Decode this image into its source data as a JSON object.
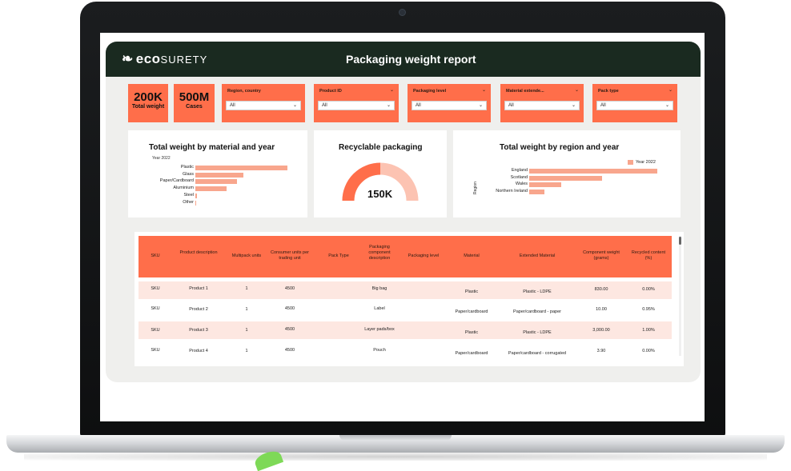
{
  "header": {
    "logo_text_bold": "eco",
    "logo_text_rest": "SURETY",
    "title": "Packaging weight report"
  },
  "kpis": [
    {
      "value": "200K",
      "label": "Total weight"
    },
    {
      "value": "500M",
      "label": "Cases"
    }
  ],
  "filters": [
    {
      "label": "Region, country",
      "value": "All"
    },
    {
      "label": "Product ID",
      "value": "All"
    },
    {
      "label": "Packaging level",
      "value": "All"
    },
    {
      "label": "Material extende...",
      "value": "All"
    },
    {
      "label": "Pack type",
      "value": "All"
    }
  ],
  "material_chart": {
    "title": "Total weight by material and year",
    "subtitle": "Year 2022",
    "chart_data": {
      "type": "bar",
      "categories": [
        "Plastic",
        "Glass",
        "Paper/Cardboard",
        "Aluminium",
        "Steel",
        "Other"
      ],
      "values": [
        100,
        52,
        45,
        34,
        2,
        1
      ],
      "xlim": [
        0,
        100
      ]
    }
  },
  "recyclable": {
    "title": "Recyclable packaging",
    "value": "150K",
    "fraction": 0.5
  },
  "region_chart": {
    "title": "Total weight by region and year",
    "legend": "Year 2022",
    "axis_title": "Region",
    "chart_data": {
      "type": "bar",
      "categories": [
        "England",
        "Scotland",
        "Wales",
        "Northern Ireland"
      ],
      "values": [
        100,
        57,
        25,
        12
      ],
      "xlim": [
        0,
        100
      ]
    }
  },
  "table": {
    "columns": [
      "SKU",
      "Product description",
      "Multipack units",
      "Consumer units per trading unit",
      "Pack Type",
      "Packaging component description",
      "Packaging level",
      "Material",
      "Extended Material",
      "Component weight (grams)",
      "Recycled content (%)"
    ],
    "rows": [
      [
        "SKU",
        "Product 1",
        "1",
        "4500",
        "",
        "Big bag",
        "",
        "Plastic",
        "Plastic - LDPE",
        "830.00",
        "0.00%"
      ],
      [
        "SKU",
        "Product 2",
        "1",
        "4500",
        "",
        "Label",
        "",
        "Paper/cardboard",
        "Paper/cardboard - paper",
        "10.00",
        "0.95%"
      ],
      [
        "SKU",
        "Product 3",
        "1",
        "4500",
        "",
        "Layer pads/box",
        "",
        "Plastic",
        "Plastic - LDPE",
        "3,000.00",
        "1.00%"
      ],
      [
        "SKU",
        "Product 4",
        "1",
        "4500",
        "",
        "Pouch",
        "",
        "Paper/cardboard",
        "Paper/cardboard - corrugated",
        "3.90",
        "0.00%"
      ]
    ]
  },
  "colors": {
    "accent": "#ff6e4a",
    "bar": "#f8a68d",
    "header_bg": "#1a2a20",
    "row_alt": "#fde7e1"
  }
}
